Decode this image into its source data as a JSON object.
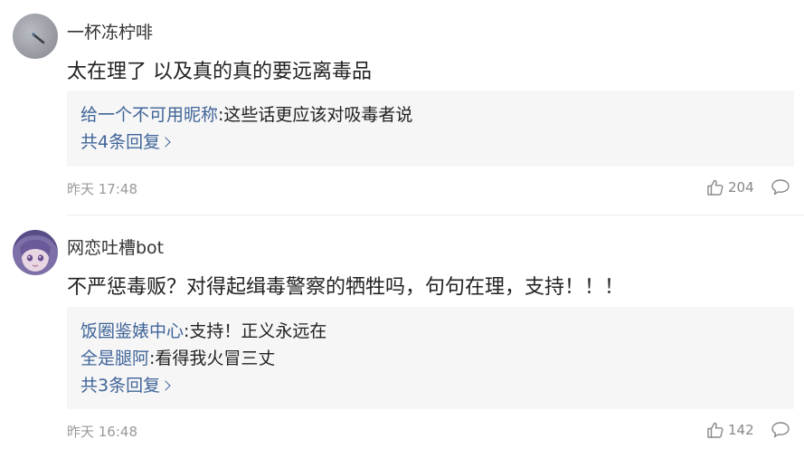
{
  "comments": [
    {
      "username": "一杯冻柠啡",
      "content": "太在理了 以及真的真的要远离毒品",
      "replies": [
        {
          "user": "给一个不可用昵称",
          "text": ":这些话更应该对吸毒者说"
        }
      ],
      "more_replies": "共4条回复",
      "time": "昨天 17:48",
      "likes": "204"
    },
    {
      "username": "网恋吐槽bot",
      "content": "不严惩毒贩？对得起缉毒警察的牺牲吗，句句在理，支持！！！",
      "replies": [
        {
          "user": "饭圈鉴婊中心",
          "text": ":支持！正义永远在"
        },
        {
          "user": "全是腿阿",
          "text": ":看得我火冒三丈"
        }
      ],
      "more_replies": "共3条回复",
      "time": "昨天 16:48",
      "likes": "142"
    }
  ],
  "colors": {
    "link": "#406599",
    "meta": "#999999",
    "reply_bg": "#f6f6f6"
  },
  "icons": {
    "like": "thumbs-up-icon",
    "reply": "comment-bubble-icon"
  }
}
